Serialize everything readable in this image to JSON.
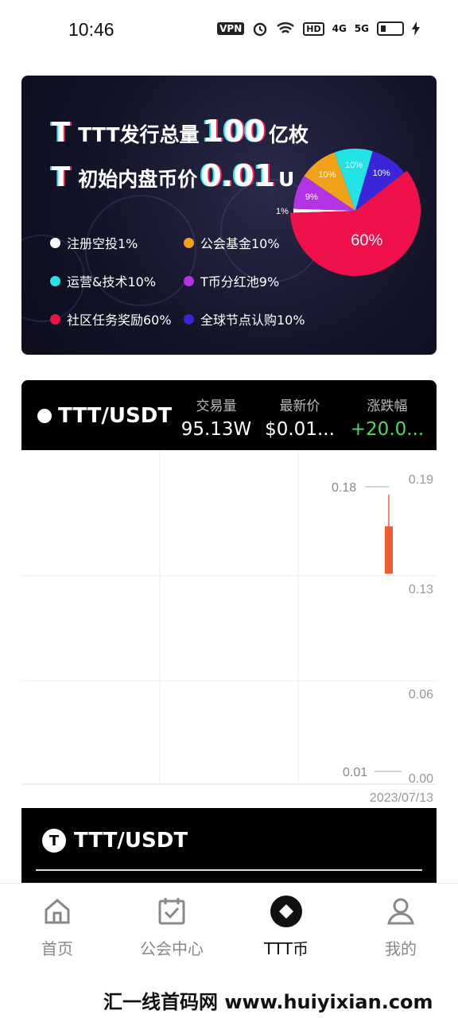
{
  "status_bar": {
    "time": "10:46",
    "vpn": "VPN",
    "hd": "HD",
    "net1": "4G",
    "net2": "5G"
  },
  "banner": {
    "line1_prefix": "TTT发行总量",
    "line1_value": "100",
    "line1_suffix": "亿枚",
    "line2_prefix": "初始内盘币价",
    "line2_value": "0.01",
    "line2_suffix": "U",
    "legend": [
      {
        "label": "注册空投1%",
        "color": "#ffffff"
      },
      {
        "label": "公会基金10%",
        "color": "#f0a21a"
      },
      {
        "label": "运营&技术10%",
        "color": "#22e4e6"
      },
      {
        "label": "T币分红池9%",
        "color": "#b433e6"
      },
      {
        "label": "社区任务奖励60%",
        "color": "#f0104a"
      },
      {
        "label": "全球节点认购10%",
        "color": "#3a25d8"
      }
    ],
    "pie": {
      "type": "pie",
      "slices": [
        {
          "label": "1%",
          "value": 1,
          "color": "#ffffff"
        },
        {
          "label": "9%",
          "value": 9,
          "color": "#b433e6"
        },
        {
          "label": "10%",
          "value": 10,
          "color": "#f0a21a"
        },
        {
          "label": "10%",
          "value": 10,
          "color": "#22e4e6"
        },
        {
          "label": "10%",
          "value": 10,
          "color": "#3a25d8"
        },
        {
          "label": "60%",
          "value": 60,
          "color": "#f0104a"
        }
      ]
    }
  },
  "market": {
    "pair": "TTT/USDT",
    "stats": [
      {
        "label": "交易量",
        "value": "95.13W",
        "color": "#ffffff"
      },
      {
        "label": "最新价",
        "value": "$0.01...",
        "color": "#ffffff"
      },
      {
        "label": "涨跌幅",
        "value": "+20.0...",
        "color": "#4cd964"
      }
    ],
    "chart": {
      "y_ticks": [
        "0.19",
        "0.13",
        "0.06",
        "0.00"
      ],
      "high_label": "0.18",
      "low_label": "0.01",
      "date": "2023/07/13",
      "candle": {
        "high": 0.18,
        "open": 0.13,
        "close": 0.16,
        "low": 0.01,
        "color": "#f25a32"
      }
    },
    "footer_pair": "TTT/USDT",
    "footer_logo": "T"
  },
  "tabs": [
    {
      "label": "首页",
      "icon": "home-icon"
    },
    {
      "label": "公会中心",
      "icon": "calendar-check-icon"
    },
    {
      "label": "TTT币",
      "icon": "coin-icon"
    },
    {
      "label": "我的",
      "icon": "user-icon"
    }
  ],
  "watermark": "汇一线首码网 www.huiyixian.com"
}
